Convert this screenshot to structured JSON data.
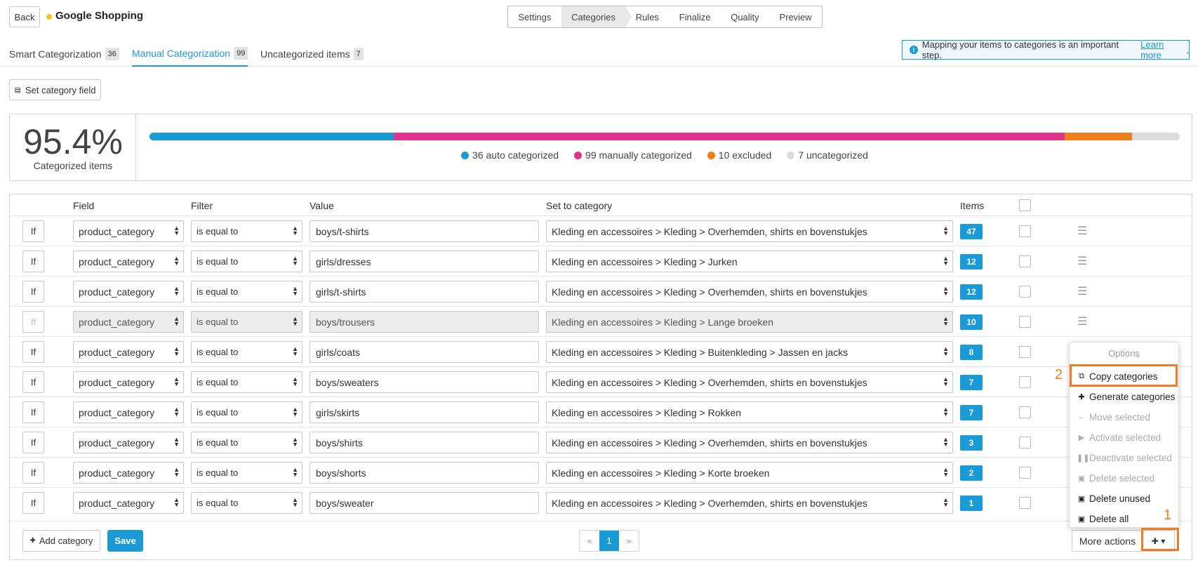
{
  "header": {
    "back_label": "Back",
    "title": "Google Shopping",
    "status_color": "#f5c518",
    "steps": [
      "Settings",
      "Categories",
      "Rules",
      "Finalize",
      "Quality",
      "Preview"
    ]
  },
  "tabs": [
    {
      "label": "Smart Categorization",
      "count": "36"
    },
    {
      "label": "Manual Categorization",
      "count": "99"
    },
    {
      "label": "Uncategorized items",
      "count": "7"
    }
  ],
  "info": {
    "text": "Mapping your items to categories is an important step.",
    "link": "Learn more",
    "period": "."
  },
  "set_field_label": "Set category field",
  "stats": {
    "percent": "95.4%",
    "label": "Categorized items",
    "segments": [
      {
        "text": "36 auto categorized",
        "value": 36,
        "color": "#1a9ad6"
      },
      {
        "text": "99 manually categorized",
        "value": 99,
        "color": "#e0338a"
      },
      {
        "text": "10 excluded",
        "value": 10,
        "color": "#ee7d1c"
      },
      {
        "text": "7 uncategorized",
        "value": 7,
        "color": "#dcdcdc"
      }
    ]
  },
  "table": {
    "headers": {
      "field": "Field",
      "filter": "Filter",
      "value": "Value",
      "category": "Set to category",
      "items": "Items"
    },
    "rows": [
      {
        "if": "If",
        "field": "product_category",
        "filter": "is equal to",
        "value": "boys/t-shirts",
        "category": "Kleding en accessoires > Kleding > Overhemden, shirts en bovenstukjes",
        "items": "47"
      },
      {
        "if": "If",
        "field": "product_category",
        "filter": "is equal to",
        "value": "girls/dresses",
        "category": "Kleding en accessoires > Kleding > Jurken",
        "items": "12"
      },
      {
        "if": "If",
        "field": "product_category",
        "filter": "is equal to",
        "value": "girls/t-shirts",
        "category": "Kleding en accessoires > Kleding > Overhemden, shirts en bovenstukjes",
        "items": "12"
      },
      {
        "if": "If",
        "field": "product_category",
        "filter": "is equal to",
        "value": "boys/trousers",
        "category": "Kleding en accessoires > Kleding > Lange broeken",
        "items": "10"
      },
      {
        "if": "If",
        "field": "product_category",
        "filter": "is equal to",
        "value": "girls/coats",
        "category": "Kleding en accessoires > Kleding > Buitenkleding > Jassen en jacks",
        "items": "8"
      },
      {
        "if": "If",
        "field": "product_category",
        "filter": "is equal to",
        "value": "boys/sweaters",
        "category": "Kleding en accessoires > Kleding > Overhemden, shirts en bovenstukjes",
        "items": "7"
      },
      {
        "if": "If",
        "field": "product_category",
        "filter": "is equal to",
        "value": "girls/skirts",
        "category": "Kleding en accessoires > Kleding > Rokken",
        "items": "7"
      },
      {
        "if": "If",
        "field": "product_category",
        "filter": "is equal to",
        "value": "boys/shirts",
        "category": "Kleding en accessoires > Kleding > Overhemden, shirts en bovenstukjes",
        "items": "3"
      },
      {
        "if": "If",
        "field": "product_category",
        "filter": "is equal to",
        "value": "boys/shorts",
        "category": "Kleding en accessoires > Kleding > Korte broeken",
        "items": "2"
      },
      {
        "if": "If",
        "field": "product_category",
        "filter": "is equal to",
        "value": "boys/sweater",
        "category": "Kleding en accessoires > Kleding > Overhemden, shirts en bovenstukjes",
        "items": "1"
      }
    ]
  },
  "footer": {
    "add_label": "Add category",
    "save_label": "Save",
    "pager": {
      "prev": "«",
      "current": "1",
      "next": "»"
    },
    "more_label": "More actions"
  },
  "menu": {
    "header": "Options",
    "items": [
      {
        "label": "Copy categories",
        "icon": "copy-icon"
      },
      {
        "label": "Generate categories",
        "icon": "plus-circle-icon"
      },
      {
        "label": "Move selected",
        "icon": "arrow-left-icon"
      },
      {
        "label": "Activate selected",
        "icon": "play-icon"
      },
      {
        "label": "Deactivate selected",
        "icon": "pause-icon"
      },
      {
        "label": "Delete selected",
        "icon": "trash-icon"
      },
      {
        "label": "Delete unused",
        "icon": "trash-icon"
      },
      {
        "label": "Delete all",
        "icon": "trash-icon"
      }
    ]
  },
  "annotations": {
    "one": "1",
    "two": "2"
  }
}
